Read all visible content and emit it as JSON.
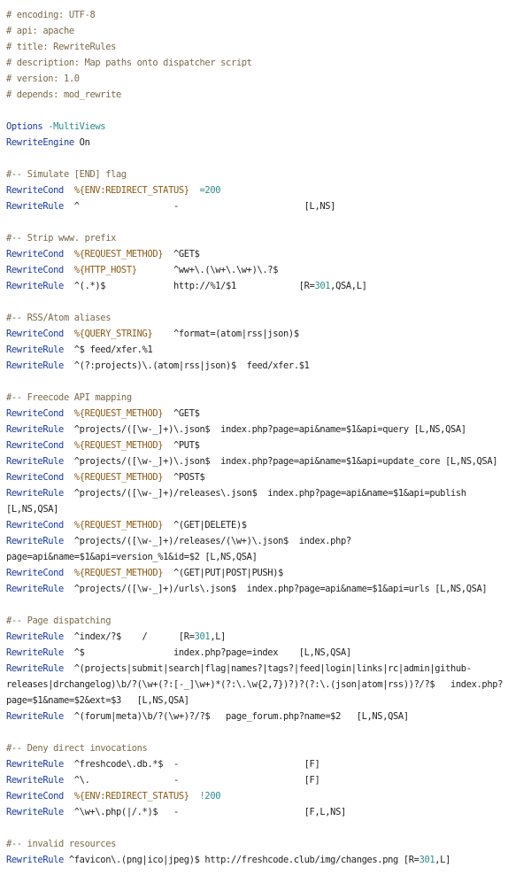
{
  "lines": [
    [
      [
        "c",
        "# encoding: UTF-8"
      ]
    ],
    [
      [
        "c",
        "# api: apache"
      ]
    ],
    [
      [
        "c",
        "# title: RewriteRules"
      ]
    ],
    [
      [
        "c",
        "# description: Map paths onto dispatcher script"
      ]
    ],
    [
      [
        "c",
        "# version: 1.0"
      ]
    ],
    [
      [
        "c",
        "# depends: mod_rewrite"
      ]
    ],
    [],
    [
      [
        "k",
        "Options "
      ],
      [
        "o",
        "-MultiViews"
      ]
    ],
    [
      [
        "k",
        "RewriteEngine"
      ],
      [
        "p",
        " On"
      ]
    ],
    [],
    [
      [
        "c",
        "#-- Simulate [END] flag"
      ]
    ],
    [
      [
        "k",
        "RewriteCond"
      ],
      [
        "p",
        "  "
      ],
      [
        "v",
        "%{ENV:REDIRECT_STATUS}"
      ],
      [
        "p",
        "  "
      ],
      [
        "o",
        "=200"
      ]
    ],
    [
      [
        "k",
        "RewriteRule"
      ],
      [
        "p",
        "  ^                  -                        [L,NS]"
      ]
    ],
    [],
    [
      [
        "c",
        "#-- Strip www. prefix"
      ]
    ],
    [
      [
        "k",
        "RewriteCond"
      ],
      [
        "p",
        "  "
      ],
      [
        "v",
        "%{REQUEST_METHOD}"
      ],
      [
        "p",
        "  ^GET$"
      ]
    ],
    [
      [
        "k",
        "RewriteCond"
      ],
      [
        "p",
        "  "
      ],
      [
        "v",
        "%{HTTP_HOST}"
      ],
      [
        "p",
        "       ^ww+\\.(\\w+\\.\\w+)\\.?$"
      ]
    ],
    [
      [
        "k",
        "RewriteRule"
      ],
      [
        "p",
        "  ^(.*)$             http://%1/$1            [R="
      ],
      [
        "n",
        "301"
      ],
      [
        "p",
        ",QSA,L]"
      ]
    ],
    [],
    [
      [
        "c",
        "#-- RSS/Atom aliases"
      ]
    ],
    [
      [
        "k",
        "RewriteCond"
      ],
      [
        "p",
        "  "
      ],
      [
        "v",
        "%{QUERY_STRING}"
      ],
      [
        "p",
        "    ^format=(atom|rss|json)$"
      ]
    ],
    [
      [
        "k",
        "RewriteRule"
      ],
      [
        "p",
        "  ^$ feed/xfer.%1"
      ]
    ],
    [
      [
        "k",
        "RewriteRule"
      ],
      [
        "p",
        "  ^(?:projects)\\.(atom|rss|json)$  feed/xfer.$1"
      ]
    ],
    [],
    [
      [
        "c",
        "#-- Freecode API mapping"
      ]
    ],
    [
      [
        "k",
        "RewriteCond"
      ],
      [
        "p",
        "  "
      ],
      [
        "v",
        "%{REQUEST_METHOD}"
      ],
      [
        "p",
        "  ^GET$"
      ]
    ],
    [
      [
        "k",
        "RewriteRule"
      ],
      [
        "p",
        "  ^projects/([\\w-_]+)\\.json$  index.php?page=api&name=$1&api=query [L,NS,QSA]"
      ]
    ],
    [
      [
        "k",
        "RewriteCond"
      ],
      [
        "p",
        "  "
      ],
      [
        "v",
        "%{REQUEST_METHOD}"
      ],
      [
        "p",
        "  ^PUT$"
      ]
    ],
    [
      [
        "k",
        "RewriteRule"
      ],
      [
        "p",
        "  ^projects/([\\w-_]+)\\.json$  index.php?page=api&name=$1&api=update_core [L,NS,QSA]"
      ]
    ],
    [
      [
        "k",
        "RewriteCond"
      ],
      [
        "p",
        "  "
      ],
      [
        "v",
        "%{REQUEST_METHOD}"
      ],
      [
        "p",
        "  ^POST$"
      ]
    ],
    [
      [
        "k",
        "RewriteRule"
      ],
      [
        "p",
        "  ^projects/([\\w-_]+)/releases\\.json$  index.php?page=api&name=$1&api=publish"
      ]
    ],
    [
      [
        "p",
        "[L,NS,QSA]"
      ]
    ],
    [
      [
        "k",
        "RewriteCond"
      ],
      [
        "p",
        "  "
      ],
      [
        "v",
        "%{REQUEST_METHOD}"
      ],
      [
        "p",
        "  ^(GET|DELETE)$"
      ]
    ],
    [
      [
        "k",
        "RewriteRule"
      ],
      [
        "p",
        "  ^projects/([\\w-_]+)/releases/(\\w+)\\.json$  index.php?"
      ]
    ],
    [
      [
        "p",
        "page=api&name=$1&api=version_%1&id=$2 [L,NS,QSA]"
      ]
    ],
    [
      [
        "k",
        "RewriteCond"
      ],
      [
        "p",
        "  "
      ],
      [
        "v",
        "%{REQUEST_METHOD}"
      ],
      [
        "p",
        "  ^(GET|PUT|POST|PUSH)$"
      ]
    ],
    [
      [
        "k",
        "RewriteRule"
      ],
      [
        "p",
        "  ^projects/([\\w-_]+)/urls\\.json$  index.php?page=api&name=$1&api=urls [L,NS,QSA]"
      ]
    ],
    [],
    [
      [
        "c",
        "#-- Page dispatching"
      ]
    ],
    [
      [
        "k",
        "RewriteRule"
      ],
      [
        "p",
        "  ^index/?$    /      [R="
      ],
      [
        "n",
        "301"
      ],
      [
        "p",
        ",L]"
      ]
    ],
    [
      [
        "k",
        "RewriteRule"
      ],
      [
        "p",
        "  ^$                 index.php?page=index    [L,NS,QSA]"
      ]
    ],
    [
      [
        "k",
        "RewriteRule"
      ],
      [
        "p",
        "  ^(projects|submit|search|flag|names?|tags?|feed|login|links|rc|admin|github-"
      ]
    ],
    [
      [
        "p",
        "releases|drchangelog)\\b/?(\\w+(?:[-_]\\w+)*(?:\\.\\w{2,7})?)?(?:\\.(json|atom|rss))?/?$   index.php?"
      ]
    ],
    [
      [
        "p",
        "page=$1&name=$2&ext=$3   [L,NS,QSA]"
      ]
    ],
    [
      [
        "k",
        "RewriteRule"
      ],
      [
        "p",
        "  ^(forum|meta)\\b/?(\\w+)?/?$   page_forum.php?name=$2   [L,NS,QSA]"
      ]
    ],
    [],
    [
      [
        "c",
        "#-- Deny direct invocations"
      ]
    ],
    [
      [
        "k",
        "RewriteRule"
      ],
      [
        "p",
        "  ^freshcode\\.db.*$  -                        [F]"
      ]
    ],
    [
      [
        "k",
        "RewriteRule"
      ],
      [
        "p",
        "  ^\\.                -                        [F]"
      ]
    ],
    [
      [
        "k",
        "RewriteCond"
      ],
      [
        "p",
        "  "
      ],
      [
        "v",
        "%{ENV:REDIRECT_STATUS}"
      ],
      [
        "p",
        "  "
      ],
      [
        "o",
        "!200"
      ]
    ],
    [
      [
        "k",
        "RewriteRule"
      ],
      [
        "p",
        "  ^\\w+\\.php(|/.*)$   -                        [F,L,NS]"
      ]
    ],
    [],
    [
      [
        "c",
        "#-- invalid resources"
      ]
    ],
    [
      [
        "k",
        "RewriteRule"
      ],
      [
        "p",
        " ^favicon\\.(png|ico|jpeg)$ http://freshcode.club/img/changes.png [R="
      ],
      [
        "n",
        "301"
      ],
      [
        "p",
        ",L]"
      ]
    ]
  ],
  "colors": {
    "comment": "#7a6a4a",
    "keyword": "#1a3a9e",
    "variable": "#8b5a14",
    "number": "#2e8b8b",
    "text": "#222222"
  }
}
